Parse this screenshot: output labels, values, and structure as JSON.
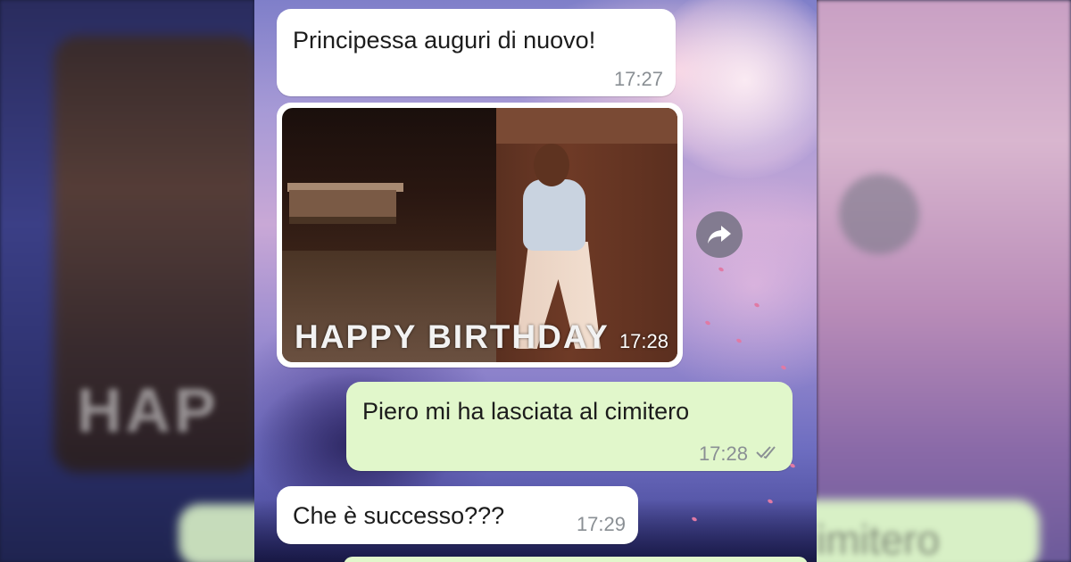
{
  "background": {
    "ghost_left_text": "HAP",
    "ghost_right_text": "imitero"
  },
  "messages": [
    {
      "direction": "incoming",
      "type": "text",
      "text": "Principessa auguri di nuovo!",
      "time": "17:27"
    },
    {
      "direction": "incoming",
      "type": "gif",
      "caption": "HAPPY BIRTHDAY",
      "time": "17:28"
    },
    {
      "direction": "outgoing",
      "type": "text",
      "text": "Piero mi ha lasciata al cimitero",
      "time": "17:28",
      "status": "read"
    },
    {
      "direction": "incoming",
      "type": "text",
      "text": "Che è successo???",
      "time": "17:29"
    }
  ],
  "icons": {
    "forward": "forward-arrow-icon",
    "read_receipt": "double-check-icon"
  },
  "colors": {
    "incoming_bubble": "#ffffff",
    "outgoing_bubble": "#e1f7cb",
    "time_text": "#8a8f94",
    "read_tick": "#8a8f94"
  }
}
